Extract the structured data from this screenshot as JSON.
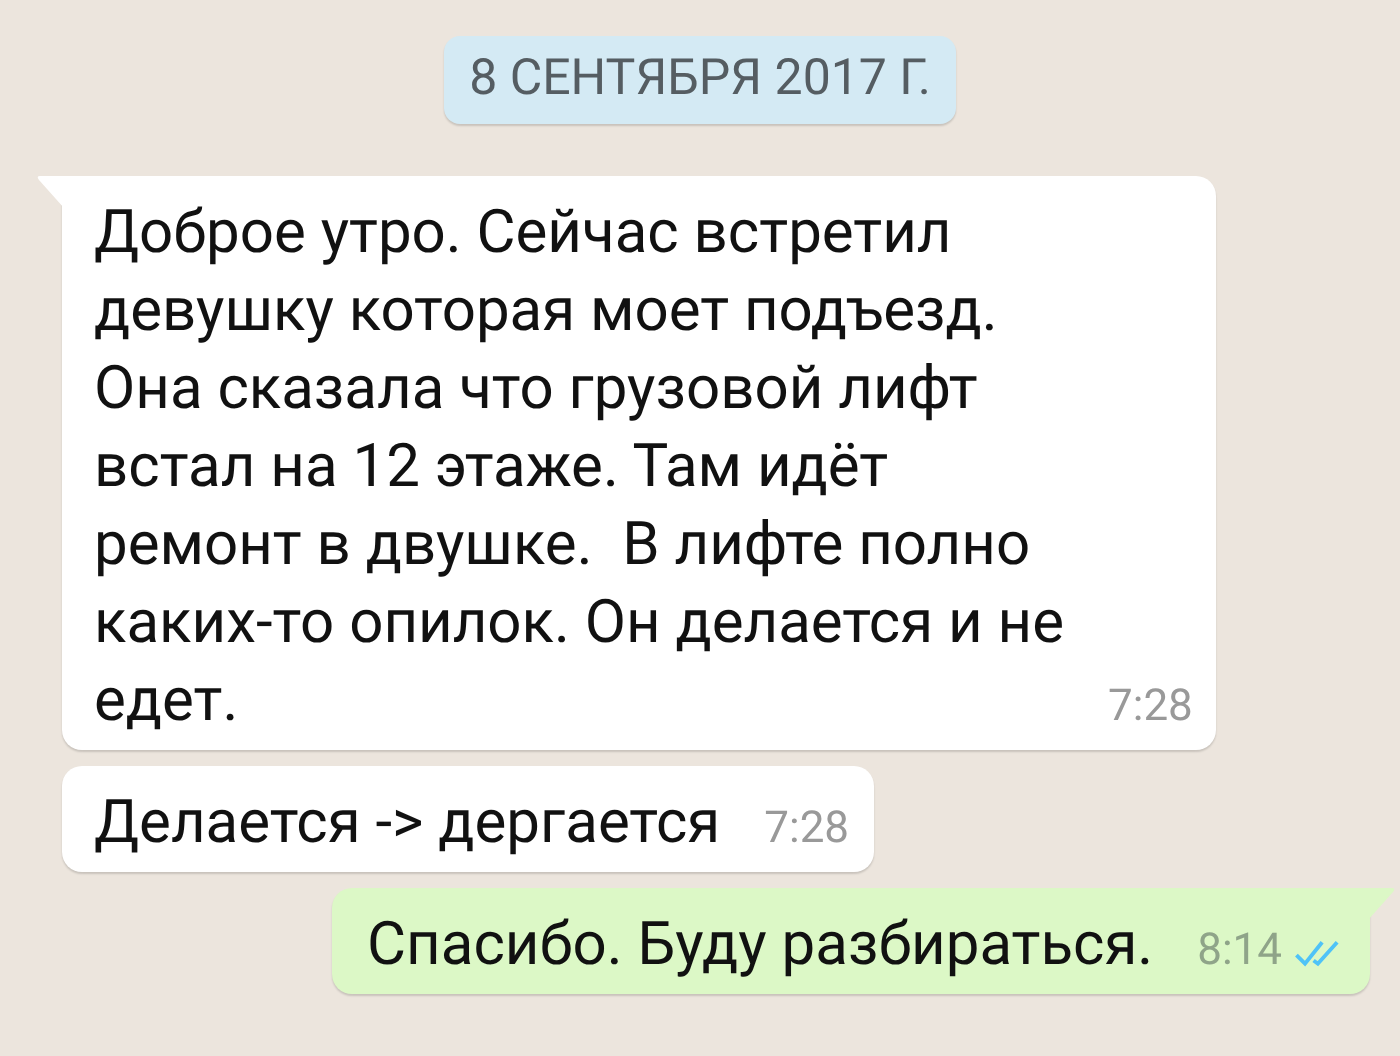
{
  "date_chip": "8 СЕНТЯБРЯ 2017 Г.",
  "messages": [
    {
      "kind": "incoming",
      "tail": true,
      "text": "Доброе утро. Сейчас встретил\nдевушку которая моет подъезд.\nОна сказала что грузовой лифт\nвстал на 12 этаже. Там идёт\nремонт в двушке.  В лифте полно\nкаких-то опилок. Он делается и не\nедет.",
      "time": "7:28"
    },
    {
      "kind": "incoming",
      "tail": false,
      "text": "Делается -> дергается",
      "time": "7:28"
    },
    {
      "kind": "outgoing",
      "tail": true,
      "text": "Спасибо. Буду разбираться.",
      "time": "8:14",
      "read": true
    }
  ]
}
